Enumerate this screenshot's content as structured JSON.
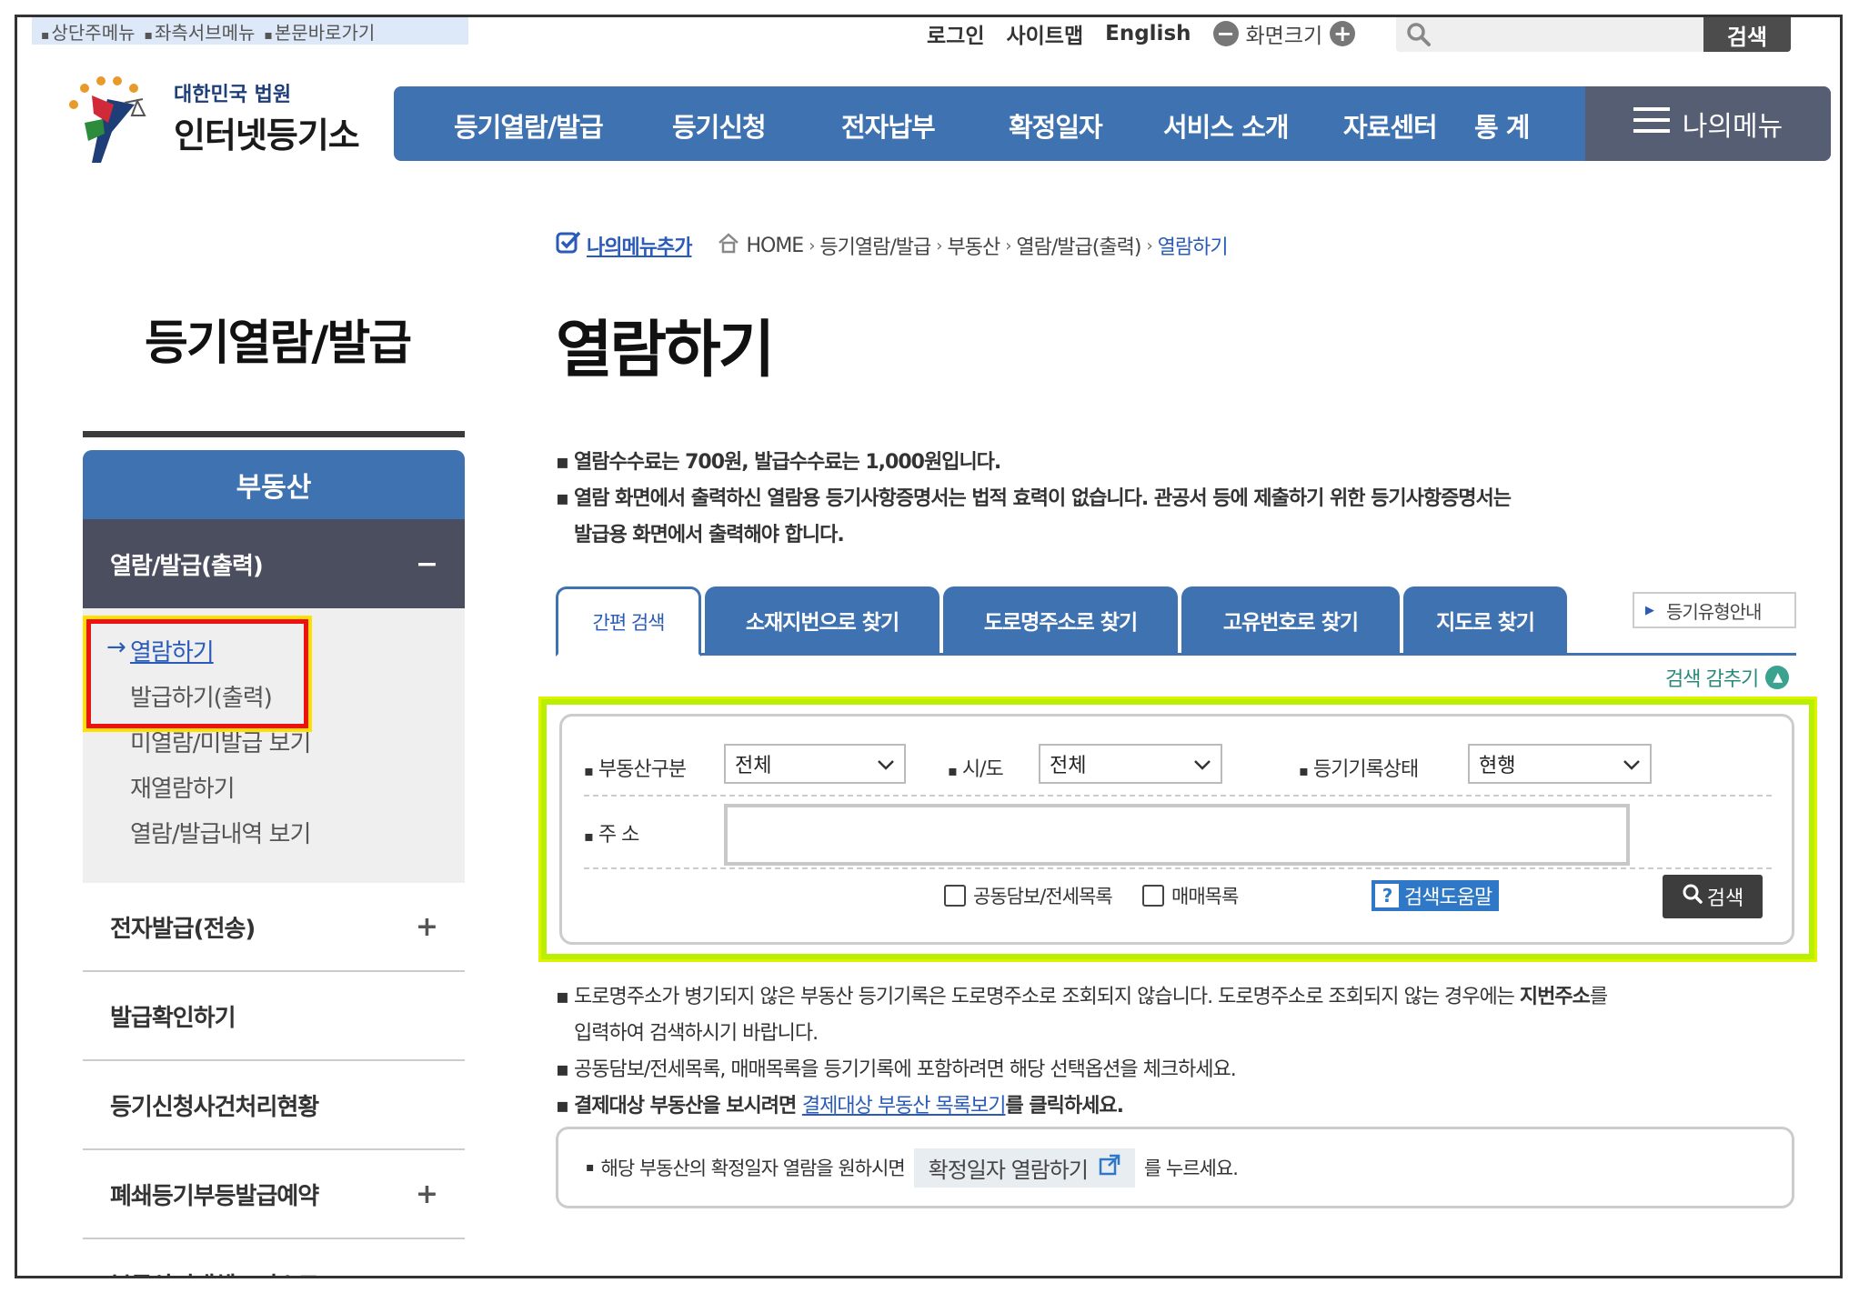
{
  "skip_links": [
    "상단주메뉴",
    "좌측서브메뉴",
    "본문바로가기"
  ],
  "util": {
    "login": "로그인",
    "sitemap": "사이트맵",
    "english": "English",
    "zoom_label": "화면크기",
    "zoom_out": "−",
    "zoom_in": "+"
  },
  "top_search": {
    "button": "검색",
    "placeholder": ""
  },
  "logo": {
    "line1": "대한민국 법원",
    "line2": "인터넷등기소"
  },
  "gnb": {
    "items": [
      "등기열람/발급",
      "등기신청",
      "전자납부",
      "확정일자",
      "서비스 소개",
      "자료센터",
      "통 계"
    ],
    "my_menu": "나의메뉴"
  },
  "side": {
    "title": "등기열람/발급",
    "head": "부동산",
    "category": "열람/발급(출력)",
    "category_toggle": "−",
    "sub_items": [
      "열람하기",
      "발급하기(출력)",
      "미열람/미발급 보기",
      "재열람하기",
      "열람/발급내역 보기"
    ],
    "active_arrow": "→",
    "others": [
      {
        "label": "전자발급(전송)",
        "toggle": "+"
      },
      {
        "label": "발급확인하기",
        "toggle": ""
      },
      {
        "label": "등기신청사건처리현황",
        "toggle": ""
      },
      {
        "label": "폐쇄등기부등발급예약",
        "toggle": "+"
      },
      {
        "label": "부동산거래체크리스트",
        "toggle": ""
      }
    ]
  },
  "breadcrumb": {
    "add_my_menu": "나의메뉴추가",
    "items": [
      "HOME",
      "등기열람/발급",
      "부동산",
      "열람/발급(출력)",
      "열람하기"
    ],
    "sep": "›"
  },
  "page_title": "열람하기",
  "notes_top": [
    "열람수수료는 700원, 발급수수료는 1,000원입니다.",
    "열람 화면에서 출력하신 열람용 등기사항증명서는 법적 효력이 없습니다. 관공서 등에 제출하기 위한 등기사항증명서는",
    "발급용 화면에서 출력해야 합니다."
  ],
  "tabs": [
    "간편 검색",
    "소재지번으로 찾기",
    "도로명주소로 찾기",
    "고유번호로 찾기",
    "지도로 찾기"
  ],
  "type_guide": "등기유형안내",
  "collapse": "검색 감추기",
  "form": {
    "property_type_label": "부동산구분",
    "property_type_value": "전체",
    "sido_label": "시/도",
    "sido_value": "전체",
    "status_label": "등기기록상태",
    "status_value": "현행",
    "address_label": "주 소",
    "address_value": "",
    "check1": "공동담보/전세목록",
    "check2": "매매목록",
    "help": "검색도움말",
    "help_icon": "?",
    "search": "검색"
  },
  "notes_bottom": {
    "road_1a": "도로명주소가 병기되지 않은 부동산 등기기록은 도로명주소로 조회되지 않습니다. 도로명주소로 조회되지 않는 경우에는 ",
    "road_1b": "지번주소",
    "road_1c": "를",
    "road_2": "입력하여 검색하시기 바랍니다.",
    "joint": "공동담보/전세목록, 매매목록을 등기기록에 포함하려면 해당 선택옵션을 체크하세요.",
    "pay_a": "결제대상 부동산을 보시려면 ",
    "pay_link": "결제대상 부동산 목록보기",
    "pay_b": "를 클릭하세요."
  },
  "confirm": {
    "text_a": "해당 부동산의 확정일자 열람을 원하시면",
    "button": "확정일자 열람하기",
    "text_b": "를 누르세요."
  },
  "colors": {
    "primary": "#3f72b0",
    "side_category": "#4a4e5e",
    "my_menu": "#565e74",
    "highlight_red": "#ee1111",
    "highlight_green": "#b8f000"
  }
}
